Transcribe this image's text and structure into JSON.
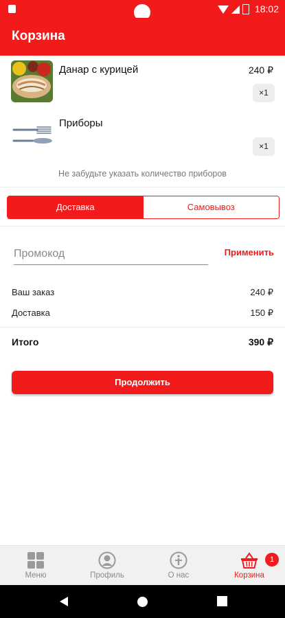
{
  "status_bar": {
    "time": "18:02"
  },
  "app_bar": {
    "title": "Корзина"
  },
  "cart": {
    "items": [
      {
        "name": "Данар с курицей",
        "price": "240 ₽",
        "qty": "×1"
      },
      {
        "name": "Приборы",
        "price": "",
        "qty": "×1"
      }
    ],
    "cutlery_hint": "Не забудьте указать количество приборов"
  },
  "delivery_toggle": {
    "options": [
      "Доставка",
      "Самовывоз"
    ],
    "selected": "Доставка"
  },
  "promo": {
    "placeholder": "Промокод",
    "value": "",
    "apply_label": "Применить"
  },
  "summary": {
    "order_label": "Ваш заказ",
    "order_value": "240 ₽",
    "delivery_label": "Доставка",
    "delivery_value": "150 ₽",
    "total_label": "Итого",
    "total_value": "390 ₽"
  },
  "continue_label": "Продолжить",
  "tab_bar": {
    "tabs": [
      {
        "label": "Меню",
        "icon": "grid-icon"
      },
      {
        "label": "Профиль",
        "icon": "person-icon"
      },
      {
        "label": "О нас",
        "icon": "info-icon"
      },
      {
        "label": "Корзина",
        "icon": "basket-icon"
      }
    ],
    "active": "Корзина",
    "cart_badge": "1"
  },
  "colors": {
    "accent": "#f21a1a",
    "tab_inactive": "#8a8a8a",
    "background": "#ffffff"
  }
}
